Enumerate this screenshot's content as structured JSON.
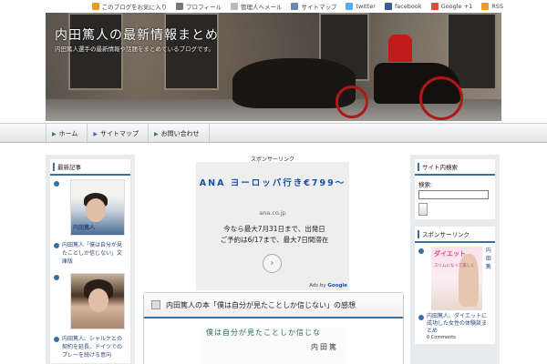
{
  "topbar": {
    "items": [
      {
        "label": "このブログをお気に入り",
        "icon": "bookmark-icon",
        "color": "#e89a2c"
      },
      {
        "label": "プロフィール",
        "icon": "profile-icon",
        "color": "#777777"
      },
      {
        "label": "管理人へメール",
        "icon": "mail-icon",
        "color": "#bbbbbb"
      },
      {
        "label": "サイトマップ",
        "icon": "sitemap-icon",
        "color": "#6a88b4"
      },
      {
        "label": "twitter",
        "icon": "twitter-icon",
        "color": "#55acee"
      },
      {
        "label": "facebook",
        "icon": "facebook-icon",
        "color": "#3b5998"
      },
      {
        "label": "Google +1",
        "icon": "google-plus-icon",
        "color": "#dd4b39"
      },
      {
        "label": "RSS",
        "icon": "rss-icon",
        "color": "#f29a1e"
      }
    ]
  },
  "header": {
    "title": "内田篤人の最新情報まとめ",
    "subtitle": "内田篤人選手の最新情報や話題をまとめているブログです。"
  },
  "nav": {
    "items": [
      "ホーム",
      "サイトマップ",
      "お問い合わせ"
    ]
  },
  "left_sidebar": {
    "title": "最新記事",
    "entries": [
      {
        "thumb_label": "内田篤人",
        "link": "内田篤人「僕は自分が見たことしか信じない」文庫版"
      },
      {
        "thumb_label": "",
        "link": "内田篤人、シャルケとの契約を延長、ドイツでのプレーを続ける意向"
      }
    ]
  },
  "center_ad": {
    "label": "スポンサーリンク",
    "title": "ANA ヨーロッパ行き€799〜",
    "url": "ana.co.jp",
    "desc": "今なら最大7月31日まで、出発日 ご予約は6/17まで、最大7日間滞在",
    "ads_by": "Ads by",
    "google": "Google"
  },
  "post": {
    "title": "内田篤人の本「僕は自分が見たことしか信じない」の感想",
    "img_text1": "僕は自分が見たことしか信じな",
    "img_text2": "内田篤"
  },
  "right_sidebar": {
    "search_title": "サイト内検索",
    "search_label": "検索:",
    "ads_title": "スポンサーリンク",
    "ad_img_title": "ダイエット",
    "ad_img_sub": "スリムになって美しく",
    "vlinks": "内田篤",
    "link": "内田篤人、ダイエットに成功した女性の体験談まとめ",
    "comments": "0 Comments"
  }
}
